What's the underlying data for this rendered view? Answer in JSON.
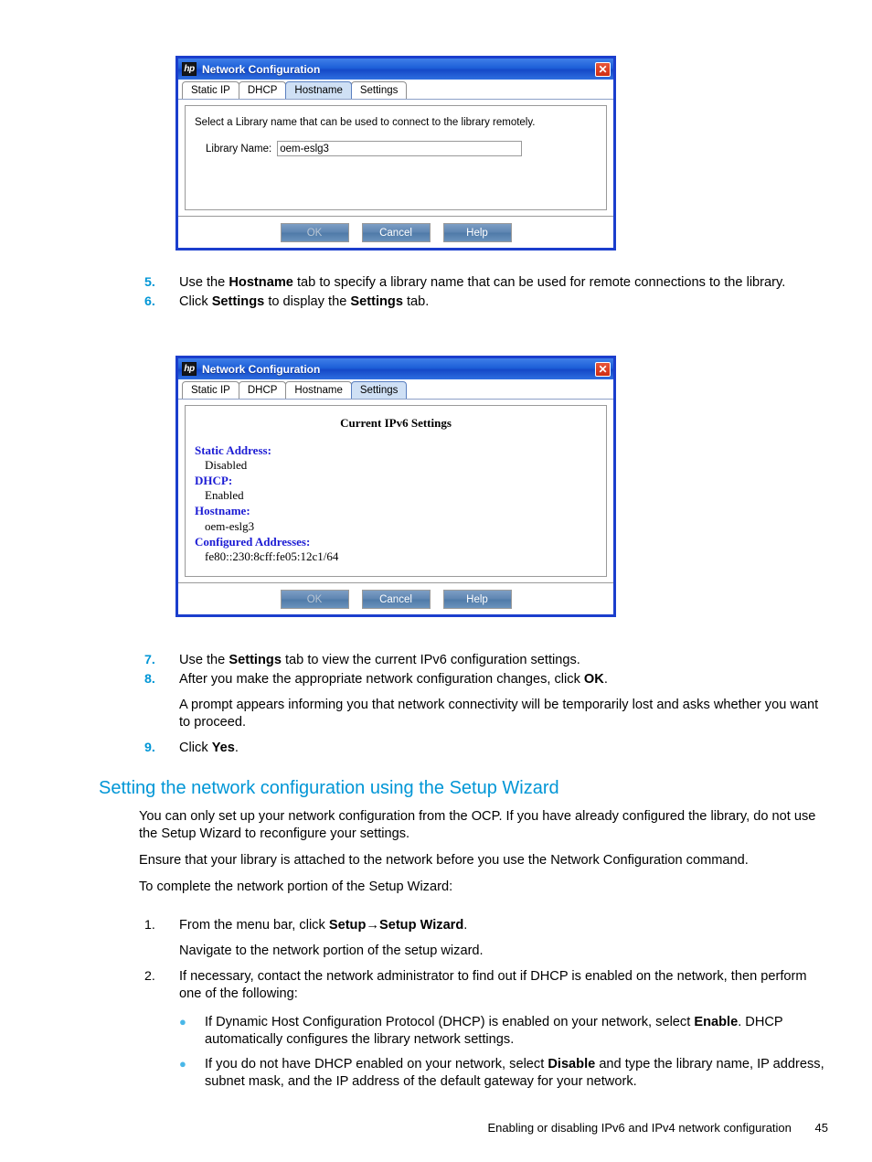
{
  "dialog1": {
    "title": "Network Configuration",
    "logo": "hp",
    "close_label": "✕",
    "tabs": [
      {
        "label": "Static IP",
        "active": false
      },
      {
        "label": "DHCP",
        "active": false
      },
      {
        "label": "Hostname",
        "active": true
      },
      {
        "label": "Settings",
        "active": false
      }
    ],
    "hint": "Select a Library name that can be used to connect to the library remotely.",
    "field_label": "Library Name:",
    "field_value": "oem-eslg3",
    "buttons": [
      {
        "label": "OK",
        "disabled": true
      },
      {
        "label": "Cancel",
        "disabled": false
      },
      {
        "label": "Help",
        "disabled": false
      }
    ]
  },
  "dialog2": {
    "title": "Network Configuration",
    "logo": "hp",
    "close_label": "✕",
    "tabs": [
      {
        "label": "Static IP",
        "active": false
      },
      {
        "label": "DHCP",
        "active": false
      },
      {
        "label": "Hostname",
        "active": false
      },
      {
        "label": "Settings",
        "active": true
      }
    ],
    "settings_title": "Current IPv6 Settings",
    "settings": [
      {
        "label": "Static Address:",
        "value": "Disabled"
      },
      {
        "label": "DHCP:",
        "value": "Enabled"
      },
      {
        "label": "Hostname:",
        "value": "oem-eslg3"
      },
      {
        "label": "Configured Addresses:",
        "value": "fe80::230:8cff:fe05:12c1/64"
      }
    ],
    "buttons": [
      {
        "label": "OK",
        "disabled": true
      },
      {
        "label": "Cancel",
        "disabled": false
      },
      {
        "label": "Help",
        "disabled": false
      }
    ]
  },
  "steps_upper": [
    {
      "num": "5.",
      "html": "Use the <b>Hostname</b> tab to specify a library name that can be used for remote connections to the library."
    },
    {
      "num": "6.",
      "html": "Click <b>Settings</b> to display the <b>Settings</b> tab."
    }
  ],
  "steps_mid": [
    {
      "num": "7.",
      "html": "Use the <b>Settings</b> tab to view the current IPv6 configuration settings."
    },
    {
      "num": "8.",
      "html": "After you make the appropriate network configuration changes, click <b>OK</b>."
    }
  ],
  "step8_note": "A prompt appears informing you that network connectivity will be temporarily lost and asks whether you want to proceed.",
  "step9": {
    "num": "9.",
    "html": "Click <b>Yes</b>."
  },
  "section": {
    "heading": "Setting the network configuration using the Setup Wizard",
    "paragraphs": [
      "You can only set up your network configuration from the OCP. If you have already configured the library, do not use the Setup Wizard to reconfigure your settings.",
      "Ensure that your library is attached to the network before you use the Network Configuration command.",
      "To complete the network portion of the Setup Wizard:"
    ]
  },
  "steps_lower": [
    {
      "num": "1.",
      "html": "From the menu bar, click <b>Setup→Setup Wizard</b>."
    }
  ],
  "step1_note": "Navigate to the network portion of the setup wizard.",
  "step2": {
    "num": "2.",
    "html": "If necessary, contact the network administrator to find out if DHCP is enabled on the network, then perform one of the following:"
  },
  "bullets": [
    {
      "marker": "●",
      "html": "If Dynamic Host Configuration Protocol (DHCP) is enabled on your network, select <b>Enable</b>. DHCP automatically configures the library network settings."
    },
    {
      "marker": "●",
      "html": "If you do not have DHCP enabled on your network, select <b>Disable</b> and type the library name, IP address, subnet mask, and the IP address of the default gateway for your network."
    }
  ],
  "footer": {
    "text": "Enabling or disabling IPv6 and IPv4 network configuration",
    "page": "45"
  },
  "colors": {
    "accent": "#0096d6",
    "dialog_border": "#1b3ecd",
    "settings_label": "#1c1cd4",
    "bullet": "#49b7e8"
  }
}
